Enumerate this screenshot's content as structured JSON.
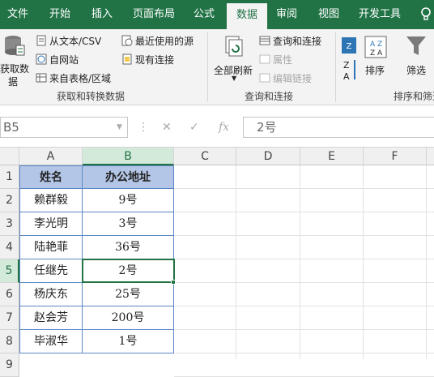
{
  "tabs": [
    "文件",
    "开始",
    "插入",
    "页面布局",
    "公式",
    "数据",
    "审阅",
    "视图",
    "开发工具"
  ],
  "ribbon": {
    "get_data": "获取数",
    "get_data2": "据",
    "from_text": "从文本/CSV",
    "from_web": "自网站",
    "from_table": "来自表格/区域",
    "recent": "最近使用的源",
    "existing": "现有连接",
    "group1": "获取和转换数据",
    "refresh_all": "全部刷新",
    "queries": "查询和连接",
    "properties": "属性",
    "edit_links": "编辑链接",
    "group2": "查询和连接",
    "sort": "排序",
    "filter": "筛选",
    "group3": "排序和筛选"
  },
  "formula_bar": {
    "name_box": "B5",
    "content": "2号",
    "fx": "fx"
  },
  "columns": [
    "A",
    "B",
    "C",
    "D",
    "E",
    "F"
  ],
  "rows": [
    "1",
    "2",
    "3",
    "4",
    "5",
    "6",
    "7",
    "8",
    "9"
  ],
  "table": {
    "headers": [
      "姓名",
      "办公地址"
    ],
    "data": [
      [
        "赖群毅",
        "9号"
      ],
      [
        "李光明",
        "3号"
      ],
      [
        "陆艳菲",
        "36号"
      ],
      [
        "任继先",
        "2号"
      ],
      [
        "杨庆东",
        "25号"
      ],
      [
        "赵会芳",
        "200号"
      ],
      [
        "毕淑华",
        "1号"
      ]
    ]
  },
  "colors": {
    "accent": "#217346",
    "header_fill": "#b4c6e7",
    "border": "#5a87c5"
  }
}
